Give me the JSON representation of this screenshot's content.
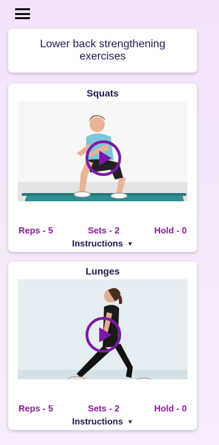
{
  "header": {
    "menu_icon": "hamburger-menu-icon"
  },
  "page_title": "Lower back strengthening exercises",
  "exercises": [
    {
      "name": "Squats",
      "reps": "Reps - 5",
      "sets": "Sets - 2",
      "hold": "Hold - 0",
      "instructions_label": "Instructions",
      "caret": "▼"
    },
    {
      "name": "Lunges",
      "reps": "Reps - 5",
      "sets": "Sets - 2",
      "hold": "Hold - 0",
      "instructions_label": "Instructions",
      "caret": "▼"
    }
  ],
  "colors": {
    "title_text": "#1d1a4e",
    "stat_text": "#8a1c9a",
    "play_ring": "#7a1aa8",
    "background": "#f3e3fa"
  }
}
